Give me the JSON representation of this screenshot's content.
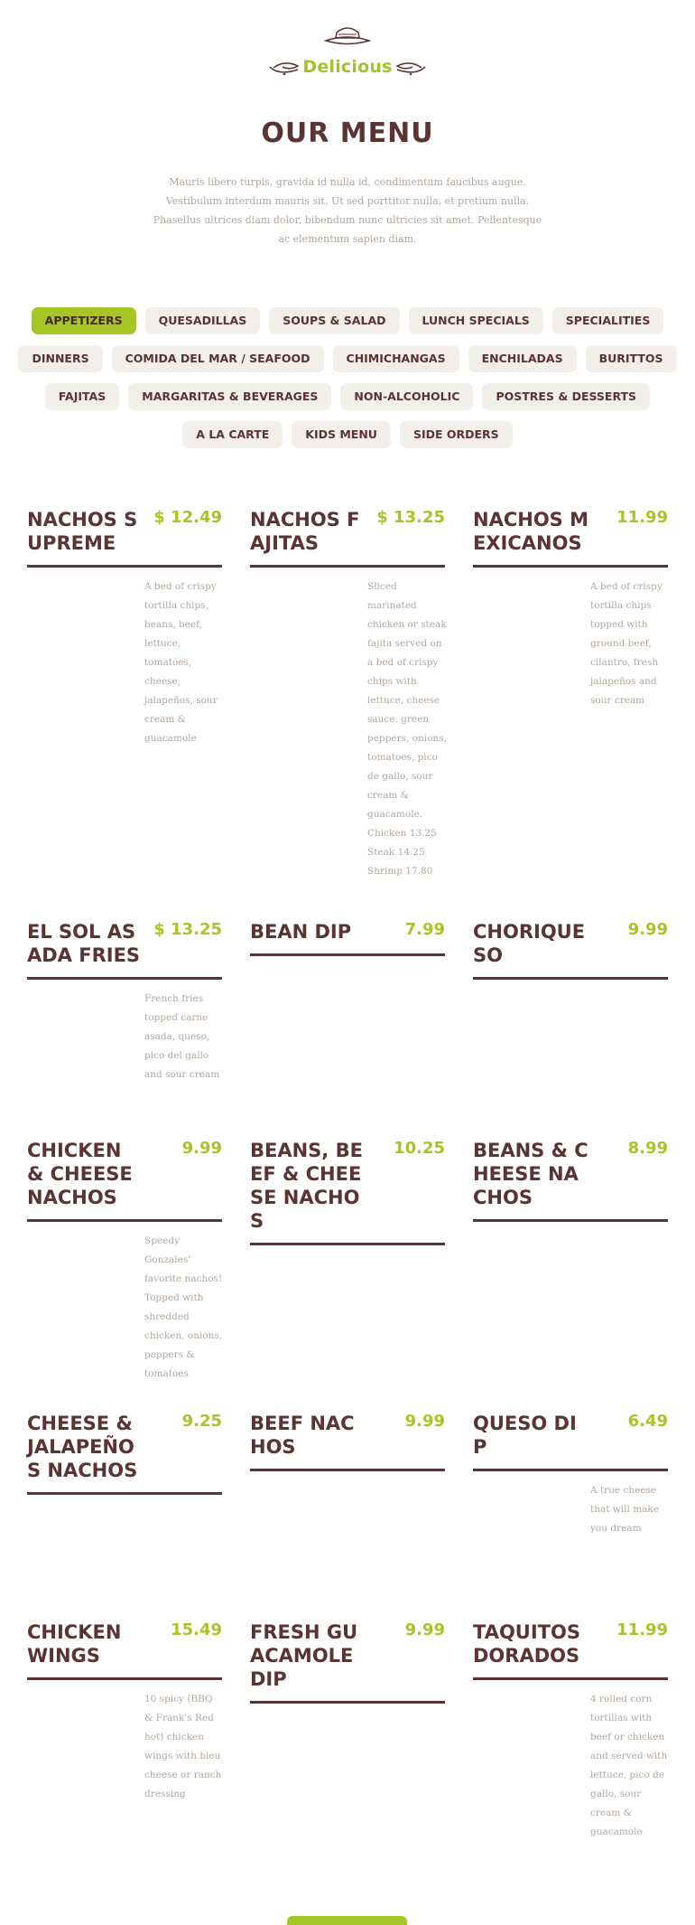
{
  "brand": {
    "logo_text": "Delicious"
  },
  "title": "OUR MENU",
  "intro": "Mauris libero turpis, gravida id nulla id, condimentum faucibus augue. Vestibulum interdum mauris sit. Ut sed porttitor nulla, et pretium nulla. Phasellus ultrices diam dolor, bibendum nunc ultricies sit amet. Pellentesque ac elementum sapien diam.",
  "colors": {
    "accent": "#a6c628",
    "brown": "#5b3332",
    "muted": "#b3a79c",
    "tab_bg": "#f2efea"
  },
  "tabs": [
    {
      "label": "APPETIZERS",
      "active": true
    },
    {
      "label": "QUESADILLAS",
      "active": false
    },
    {
      "label": "SOUPS & SALAD",
      "active": false
    },
    {
      "label": "LUNCH SPECIALS",
      "active": false
    },
    {
      "label": "SPECIALITIES",
      "active": false
    },
    {
      "label": "DINNERS",
      "active": false
    },
    {
      "label": "COMIDA DEL MAR / SEAFOOD",
      "active": false
    },
    {
      "label": "CHIMICHANGAS",
      "active": false
    },
    {
      "label": "ENCHILADAS",
      "active": false
    },
    {
      "label": "BURITTOS",
      "active": false
    },
    {
      "label": "FAJITAS",
      "active": false
    },
    {
      "label": "MARGARITAS & BEVERAGES",
      "active": false
    },
    {
      "label": "NON-ALCOHOLIC",
      "active": false
    },
    {
      "label": "POSTRES & DESSERTS",
      "active": false
    },
    {
      "label": "A LA CARTE",
      "active": false
    },
    {
      "label": "KIDS MENU",
      "active": false
    },
    {
      "label": "SIDE ORDERS",
      "active": false
    }
  ],
  "items": [
    {
      "name": "NACHOS SUPREME",
      "price": "$ 12.49",
      "desc": "A bed of crispy tortilla chips, beans, beef, lettuce, tomatoes, cheese, jalapeños, sour cream & guacamole"
    },
    {
      "name": "NACHOS FAJITAS",
      "price": "$ 13.25",
      "desc": "Sliced marinated chicken or steak fajita served on a bed of crispy chips with lettuce, cheese sauce. green peppers, onions, tomatoes, pico de gallo, sour cream & guacamole. Chicken 13.25 Steak 14.25 Shrimp 17.80"
    },
    {
      "name": "NACHOS MEXICANOS",
      "price": "11.99",
      "desc": "A bed of crispy tortilla chips topped with ground beef, cilantro, fresh jalapeños and sour cream"
    },
    {
      "name": "EL SOL ASADA FRIES",
      "price": "$ 13.25",
      "desc": "French fries topped carne asada, queso, pico del gallo and sour cream"
    },
    {
      "name": "BEAN DIP",
      "price": "7.99",
      "desc": ""
    },
    {
      "name": "CHORIQUESO",
      "price": "9.99",
      "desc": ""
    },
    {
      "name": "CHICKEN & CHEESE NACHOS",
      "price": "9.99",
      "desc": "Speedy Gonzales' favorite nachos! Topped with shredded chicken, onions, peppers & tomatoes"
    },
    {
      "name": "BEANS, BEEF & CHEESE NACHOS",
      "price": "10.25",
      "desc": ""
    },
    {
      "name": "BEANS & CHEESE NACHOS",
      "price": "8.99",
      "desc": ""
    },
    {
      "name": "CHEESE & JALAPEÑOS NACHOS",
      "price": "9.25",
      "desc": ""
    },
    {
      "name": "BEEF NACHOS",
      "price": "9.99",
      "desc": ""
    },
    {
      "name": "QUESO DIP",
      "price": "6.49",
      "desc": "A true cheese that will make you dream"
    },
    {
      "name": "CHICKEN WINGS",
      "price": "15.49",
      "desc": "10 spicy (BBQ & Frank's Red hot) chicken wings with bleu cheese or ranch dressing"
    },
    {
      "name": "FRESH GUACAMOLE DIP",
      "price": "9.99",
      "desc": ""
    },
    {
      "name": "TAQUITOS DORADOS",
      "price": "11.99",
      "desc": "4 rolled corn tortillas with beef or chicken and served with lettuce, pico de gallo, sour cream & guacamole"
    }
  ]
}
